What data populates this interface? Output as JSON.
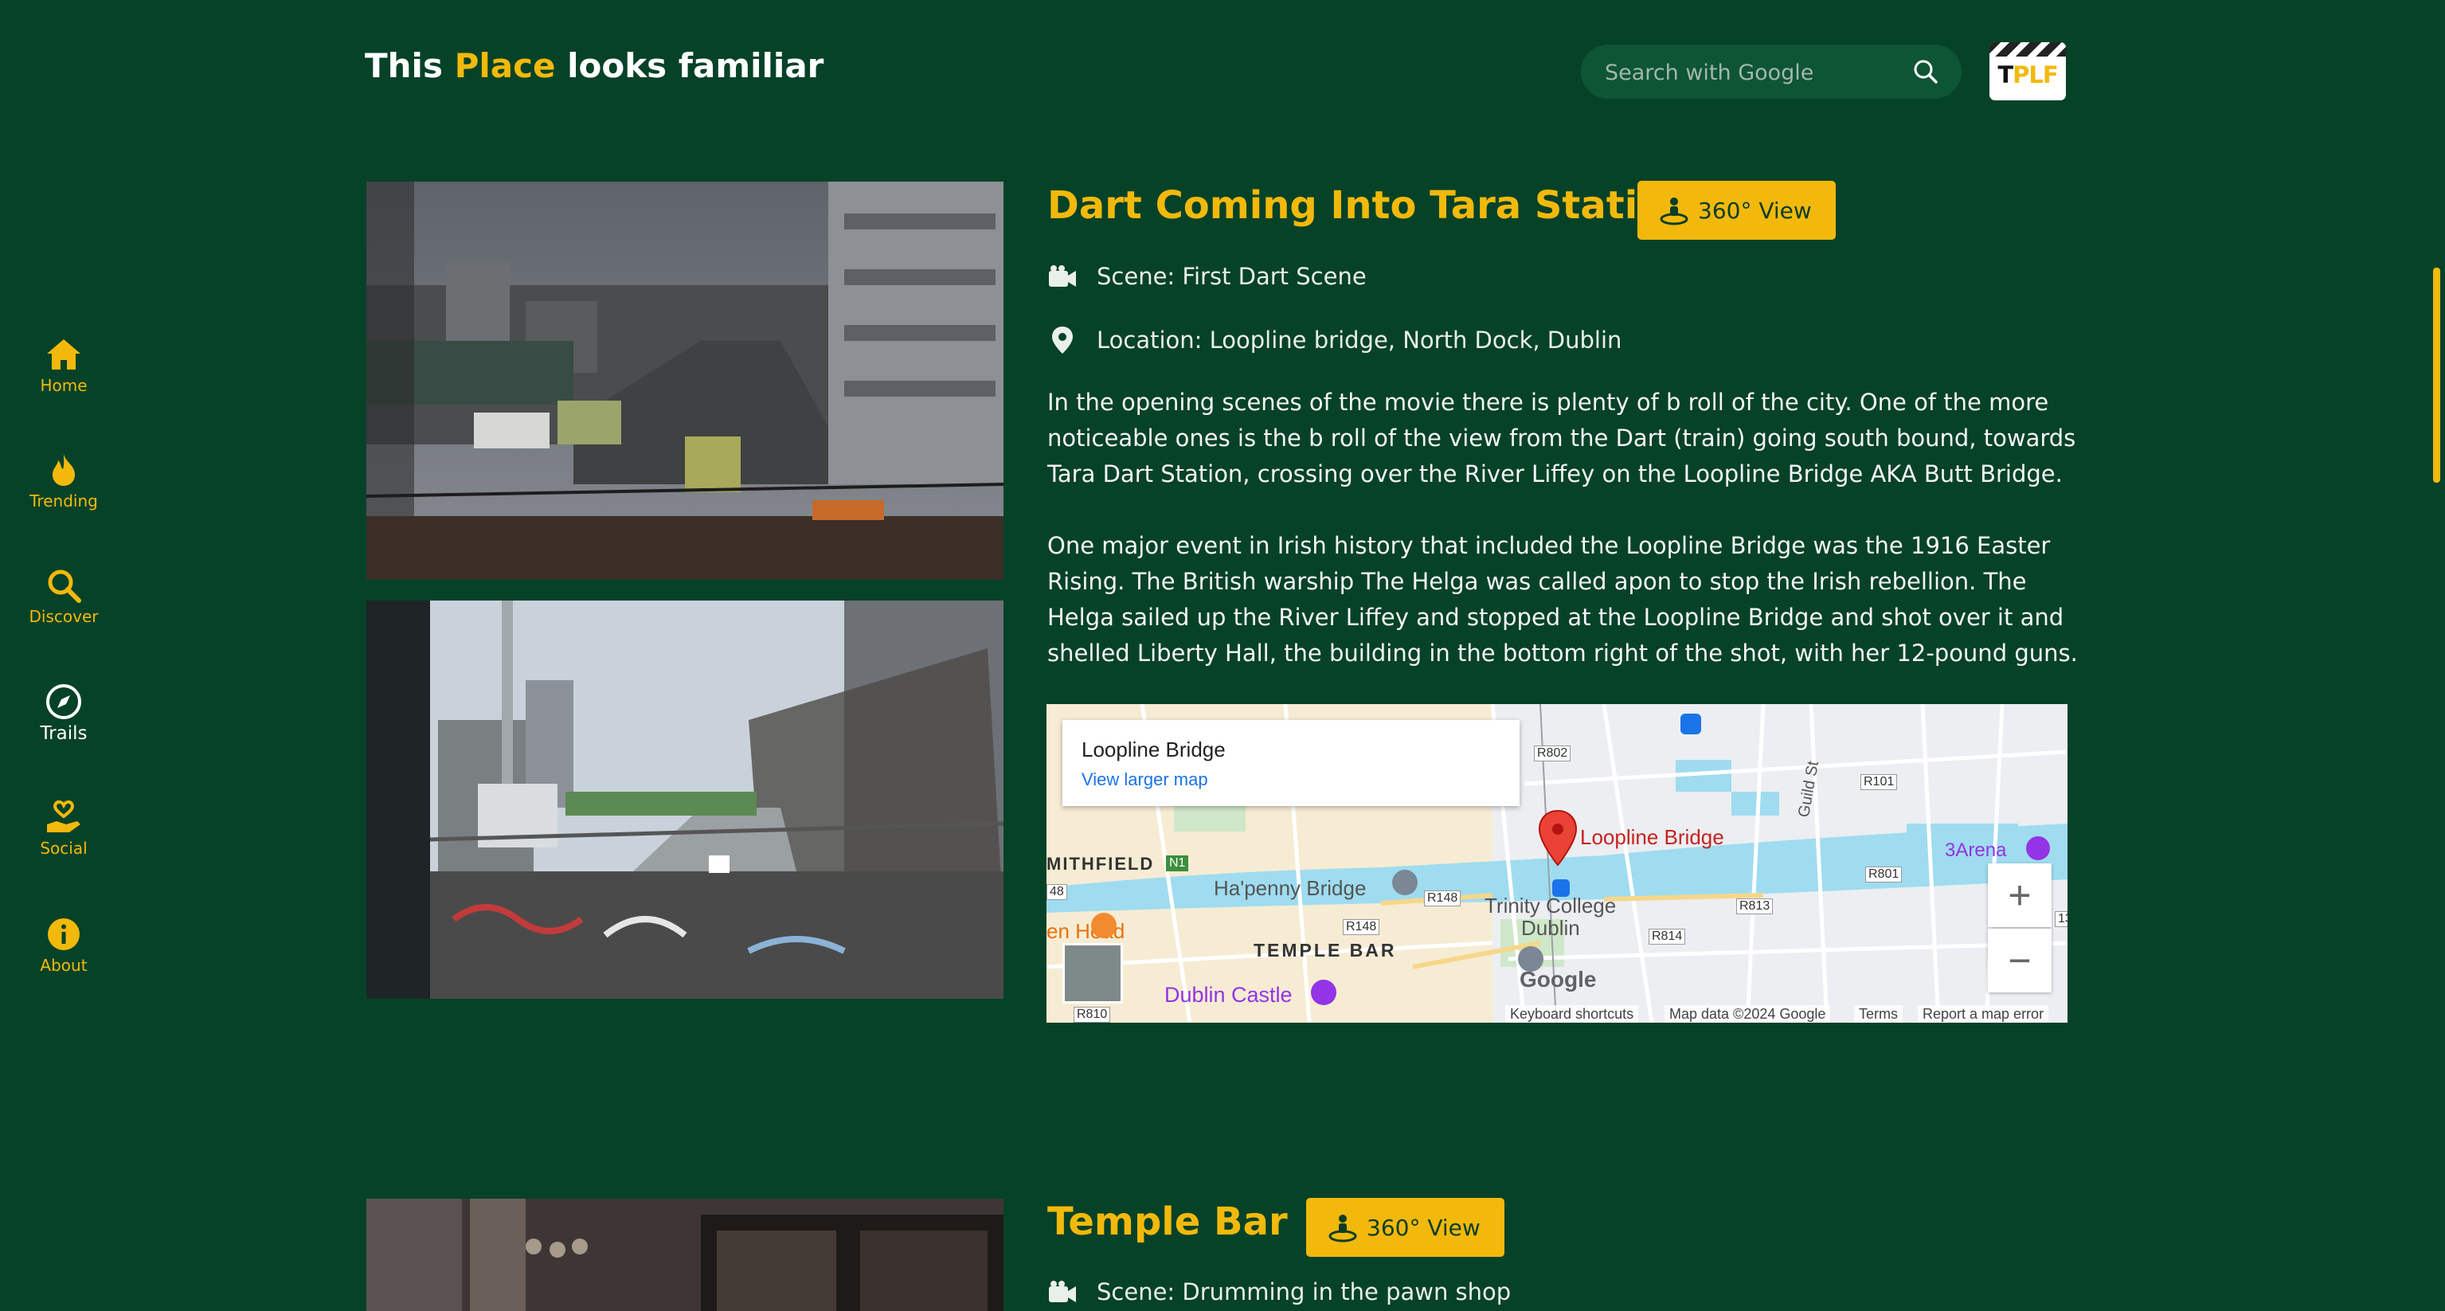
{
  "colors": {
    "background": "#064228",
    "accent": "#f2b90c",
    "text": "#ffffff"
  },
  "sidebar": {
    "items": [
      {
        "label": "Home",
        "icon": "home-icon"
      },
      {
        "label": "Trending",
        "icon": "flame-icon"
      },
      {
        "label": "Discover",
        "icon": "search-icon"
      },
      {
        "label": "Trails",
        "icon": "compass-icon",
        "active": true
      },
      {
        "label": "Social",
        "icon": "heart-hand-icon"
      },
      {
        "label": "About",
        "icon": "info-icon"
      }
    ]
  },
  "header": {
    "brand_part1": "This ",
    "brand_highlight": "Place",
    "brand_part3": " looks familiar",
    "search_placeholder": "Search with Google",
    "logo_text_a": "T",
    "logo_text_b": "PLF"
  },
  "entries": [
    {
      "title": "Dart Coming Into Tara Station",
      "view_button": "360° View",
      "scene": "Scene: First Dart Scene",
      "location": "Location: Loopline bridge, North Dock, Dublin",
      "paragraph1": "In the opening scenes of the movie there is plenty of b roll of the city. One of the more noticeable ones is the b roll of the view from the Dart (train) going south bound, towards Tara Dart Station, crossing over the River Liffey on the Loopline Bridge AKA Butt Bridge.",
      "paragraph2": "One major event in Irish history that included the Loopline Bridge was the 1916 Easter Rising. The British warship The Helga was called apon to stop the Irish rebellion. The Helga sailed up the River Liffey and stopped at the Loopline Bridge and shot over it and shelled Liberty Hall, the building in the bottom right of the shot, with her 12-pound guns."
    },
    {
      "title": "Temple Bar",
      "view_button": "360° View",
      "scene": "Scene: Drumming in the pawn shop"
    }
  ],
  "map": {
    "place_name": "Loopline Bridge",
    "larger_map_link": "View larger map",
    "pin_label": "Loopline Bridge",
    "labels": {
      "smithfield": "MITHFIELD",
      "hapenny": "Ha'penny Bridge",
      "temple_bar": "TEMPLE BAR",
      "trinity": "Trinity College",
      "dublin": "Dublin",
      "dublin_castle": "Dublin Castle",
      "arena": "3Arena",
      "guild_st": "Guild St",
      "oven_head": "en Head",
      "r802": "R802",
      "r101": "R101",
      "r801": "R801",
      "r813": "R813",
      "r814": "R814",
      "r148a": "R148",
      "r148b": "R148",
      "r810": "R810",
      "n1": "N1",
      "r48": "48",
      "r13": "13"
    },
    "zoom_in": "+",
    "zoom_out": "−",
    "attribution": {
      "keyboard": "Keyboard shortcuts",
      "mapdata": "Map data ©2024 Google",
      "terms": "Terms",
      "report": "Report a map error"
    },
    "google_logo": "Google"
  }
}
